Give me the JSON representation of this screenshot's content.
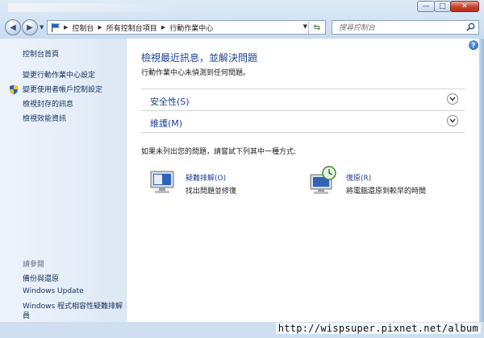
{
  "window": {
    "title_ghost": ""
  },
  "titlebar_buttons": {
    "minimize": "—",
    "maximize": "□",
    "close": "✕"
  },
  "address_bar": {
    "crumbs": [
      "控制台",
      "所有控制台項目",
      "行動作業中心"
    ]
  },
  "search": {
    "placeholder": "搜尋控制台"
  },
  "sidebar": {
    "home": "控制台首頁",
    "links": [
      "變更行動作業中心設定",
      "變更使用者帳戶控制設定",
      "檢視封存的訊息",
      "檢視效能資訊"
    ],
    "see_also_label": "請參閱",
    "see_also": [
      "備份與還原",
      "Windows Update",
      "Windows 程式相容性疑難排解員"
    ]
  },
  "main": {
    "heading": "檢視最近訊息，並解決問題",
    "subheading": "行動作業中心未偵測到任何問題。",
    "sections": [
      {
        "label": "安全性(S)"
      },
      {
        "label": "維護(M)"
      }
    ],
    "prompt": "如果未列出您的問題，請嘗試下列其中一種方式:",
    "actions": [
      {
        "title": "疑難排解(O)",
        "desc": "找出問題並修復",
        "icon": "troubleshooting-icon"
      },
      {
        "title": "復原(R)",
        "desc": "將電腦還原到較早的時間",
        "icon": "recovery-icon"
      }
    ]
  },
  "watermark": "http://wispsuper.pixnet.net/album",
  "colors": {
    "link": "#1c3f94",
    "sidebar_link": "#16325c",
    "chrome": "#bcd2ea"
  }
}
